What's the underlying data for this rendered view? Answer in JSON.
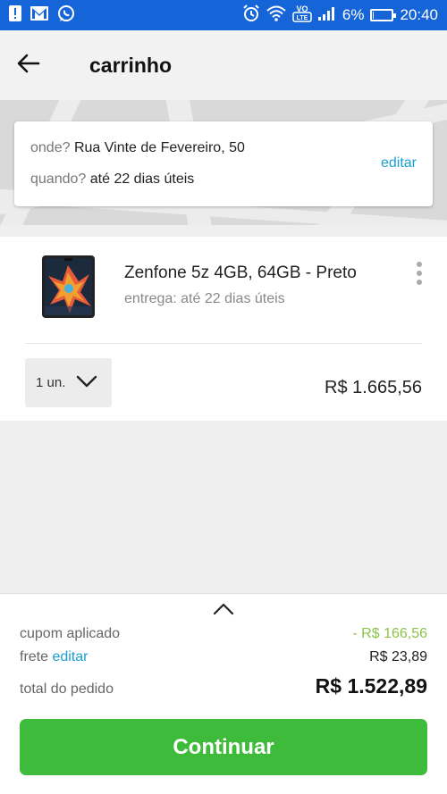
{
  "status_bar": {
    "battery": "6%",
    "time": "20:40",
    "network_badge": "VoLTE",
    "battery_level": 0.06,
    "left_icons": [
      "alert-icon",
      "gmail-icon",
      "whatsapp-icon"
    ],
    "right_icons": [
      "alarm-icon",
      "wifi-icon",
      "volte-icon",
      "signal-icon",
      "battery-icon"
    ]
  },
  "appbar": {
    "title": "carrinho"
  },
  "address": {
    "where_label": "onde?",
    "where_value": "Rua Vinte de Fevereiro, 50",
    "when_label": "quando?",
    "when_value": "até 22 dias úteis",
    "edit_label": "editar"
  },
  "item": {
    "title": "Zenfone 5z 4GB, 64GB - Preto",
    "delivery": "entrega: até 22 dias úteis",
    "quantity": "1 un.",
    "price": "R$ 1.665,56"
  },
  "summary": {
    "coupon_label": "cupom aplicado",
    "coupon_value": "- R$ 166,56",
    "shipping_label": "frete",
    "shipping_edit": "editar",
    "shipping_value": "R$ 23,89",
    "total_label": "total do pedido",
    "total_value": "R$ 1.522,89",
    "continue_label": "Continuar"
  },
  "colors": {
    "status_bar": "#1565d8",
    "accent_blue": "#1a9fd1",
    "cta_green": "#3fbb3b",
    "discount_green": "#8bc34a"
  }
}
